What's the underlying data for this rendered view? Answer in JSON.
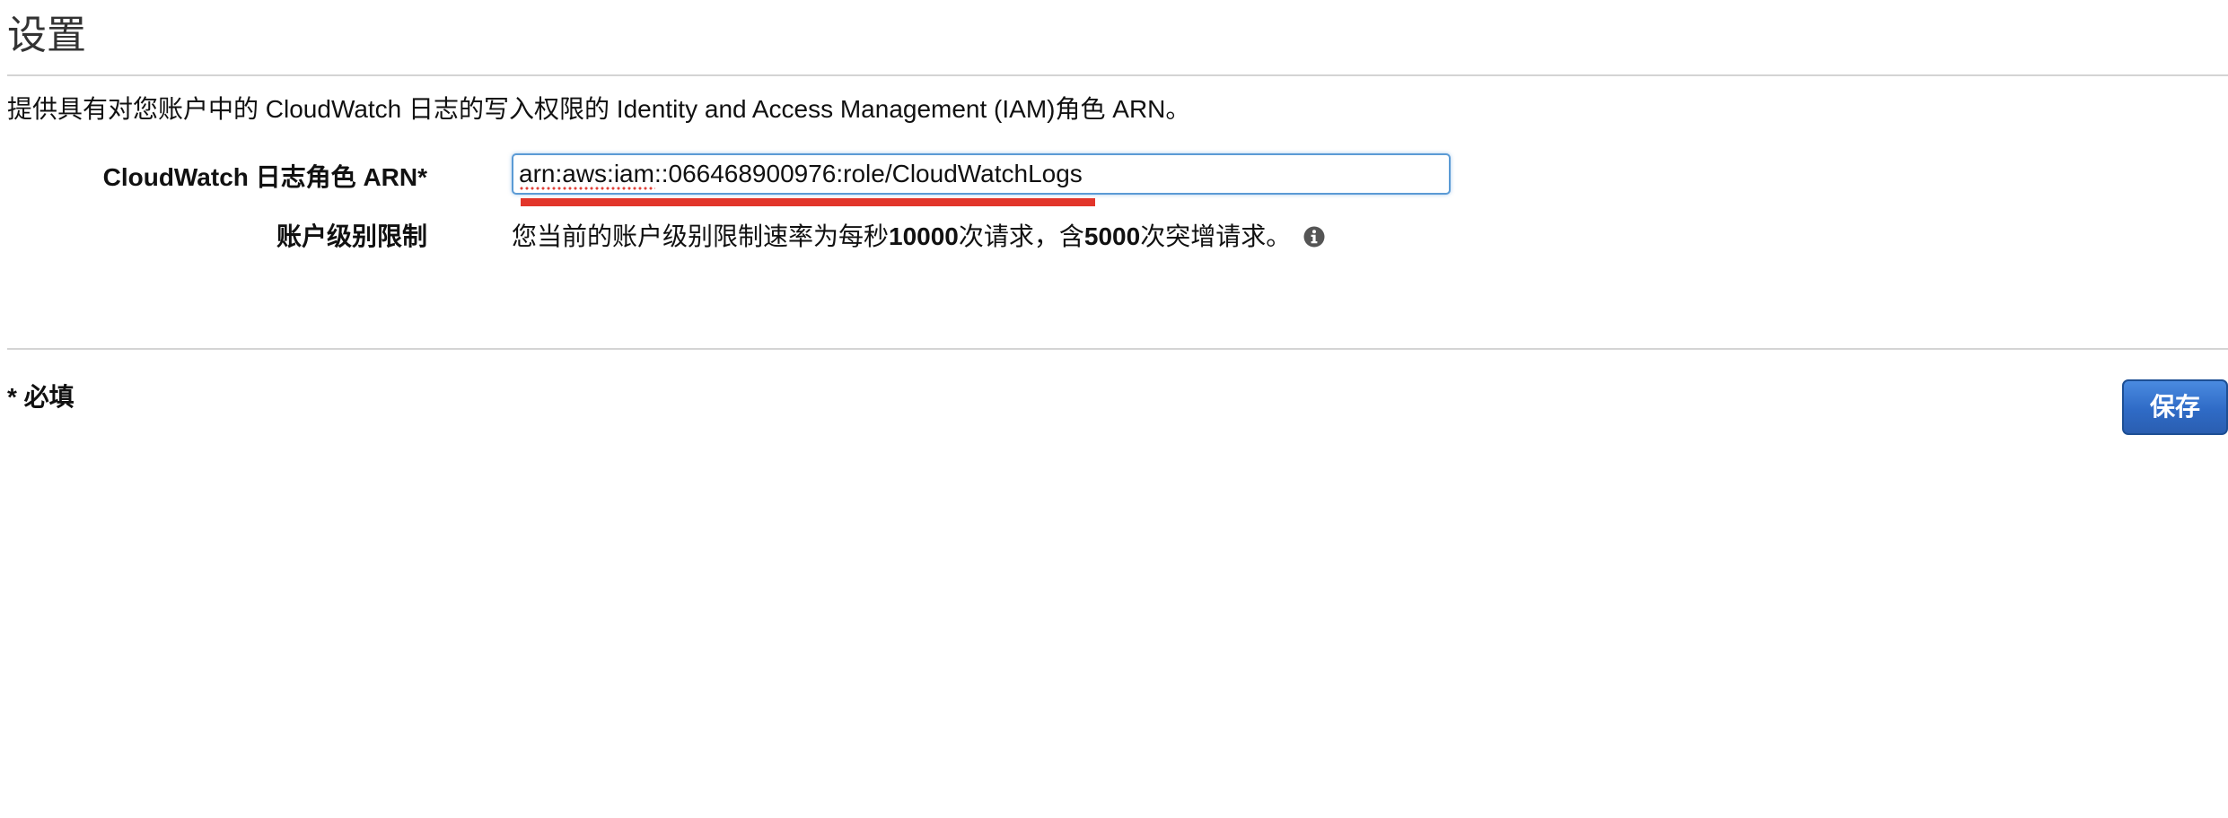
{
  "section": {
    "title": "设置",
    "description": "提供具有对您账户中的 CloudWatch 日志的写入权限的 Identity and Access Management (IAM)角色 ARN。"
  },
  "form": {
    "arn_label": "CloudWatch 日志角色 ARN*",
    "arn_value": "arn:aws:iam::066468900976:role/CloudWatchLogs",
    "limit_label": "账户级别限制",
    "limit_text_prefix": "您当前的账户级别限制速率为每秒 ",
    "limit_rate": "10000",
    "limit_text_middle": " 次请求，含 ",
    "limit_burst": "5000",
    "limit_text_suffix": " 次突增请求。",
    "info_icon": "info-icon"
  },
  "footer": {
    "required_note": "* 必填",
    "save_label": "保存"
  },
  "colors": {
    "input_border": "#5b9bd5",
    "annotation_red": "#e2352a",
    "save_button": "#2f6bc6",
    "divider": "#d4d4d4"
  }
}
